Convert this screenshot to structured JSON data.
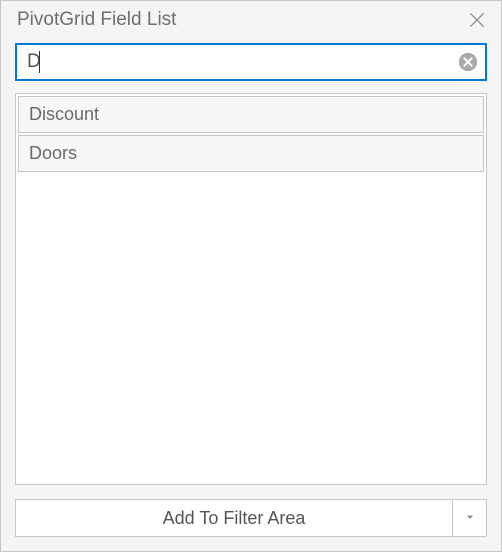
{
  "header": {
    "title": "PivotGrid Field List"
  },
  "search": {
    "value": "D",
    "placeholder": ""
  },
  "list": {
    "items": [
      {
        "label": "Discount"
      },
      {
        "label": "Doors"
      }
    ]
  },
  "footer": {
    "add_label": "Add To Filter Area"
  }
}
